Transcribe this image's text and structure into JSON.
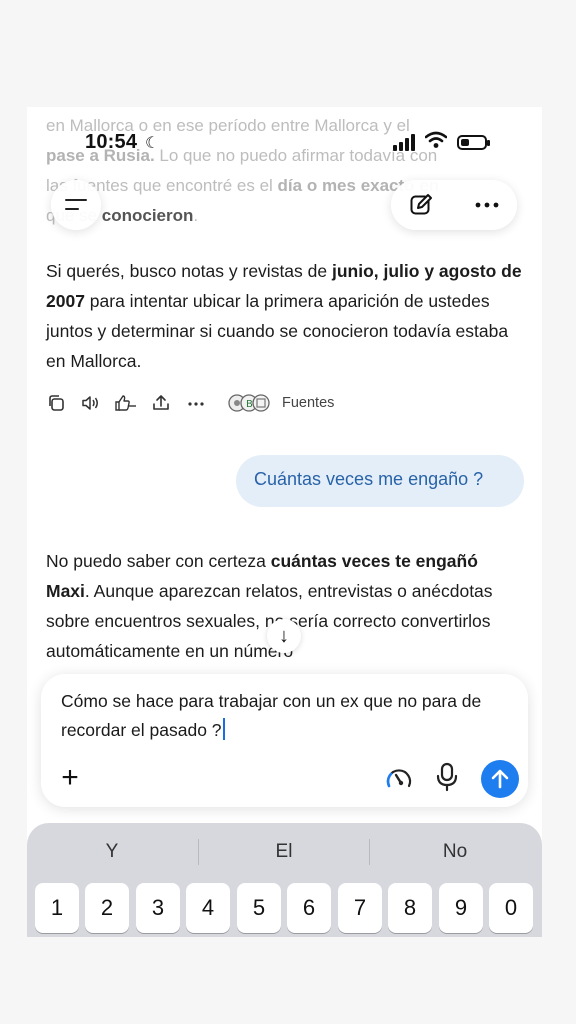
{
  "status_bar": {
    "time": "10:54"
  },
  "faded_text": {
    "line1": "en Mallorca o en ese período entre Mallorca y el",
    "line2_a": "pase a Rusia.",
    "line2_b": " Lo que no puedo afirmar todavía con",
    "line3_a": "las fuentes que encontré es el ",
    "line3_b": "día o mes exacto en",
    "line4_a": "que se ",
    "line4_b": "conocieron",
    "line4_c": "."
  },
  "assistant_message_1": {
    "seg1": "Si querés, busco notas y revistas de ",
    "seg2": "junio, julio y agosto de 2007",
    "seg3": " para intentar ubicar la primera aparición de ustedes juntos y determinar si cuando se conocieron todavía estaba en Mallorca."
  },
  "message_actions": {
    "sources_label": "Fuentes"
  },
  "user_message": {
    "text": "Cuántas veces me engaño ?"
  },
  "assistant_message_2": {
    "seg1": "No puedo saber con certeza ",
    "seg2": "cuántas veces te engañó Maxi",
    "seg3": ". Aunque aparezcan relatos, entrevistas o anécdotas sobre encuentros sexuales, no sería correcto convertirlos automáticamente en un número"
  },
  "composer": {
    "text": "Cómo se hace para trabajar con un ex que no para de recordar el pasado ?"
  },
  "keyboard": {
    "suggestions": [
      "Y",
      "El",
      "No"
    ],
    "number_keys": [
      "1",
      "2",
      "3",
      "4",
      "5",
      "6",
      "7",
      "8",
      "9",
      "0"
    ]
  },
  "colors": {
    "accent": "#1e7ef0",
    "user_bubble": "#e4eef8",
    "user_text": "#2863a8"
  },
  "icons": [
    "moon-icon",
    "signal-icon",
    "wifi-icon",
    "battery-icon",
    "menu-icon",
    "edit-icon",
    "more-icon",
    "copy-icon",
    "speaker-icon",
    "thumbs-icon",
    "share-icon",
    "sources-icon",
    "arrow-down-icon",
    "plus-icon",
    "gauge-icon",
    "mic-icon",
    "send-arrow-icon"
  ]
}
